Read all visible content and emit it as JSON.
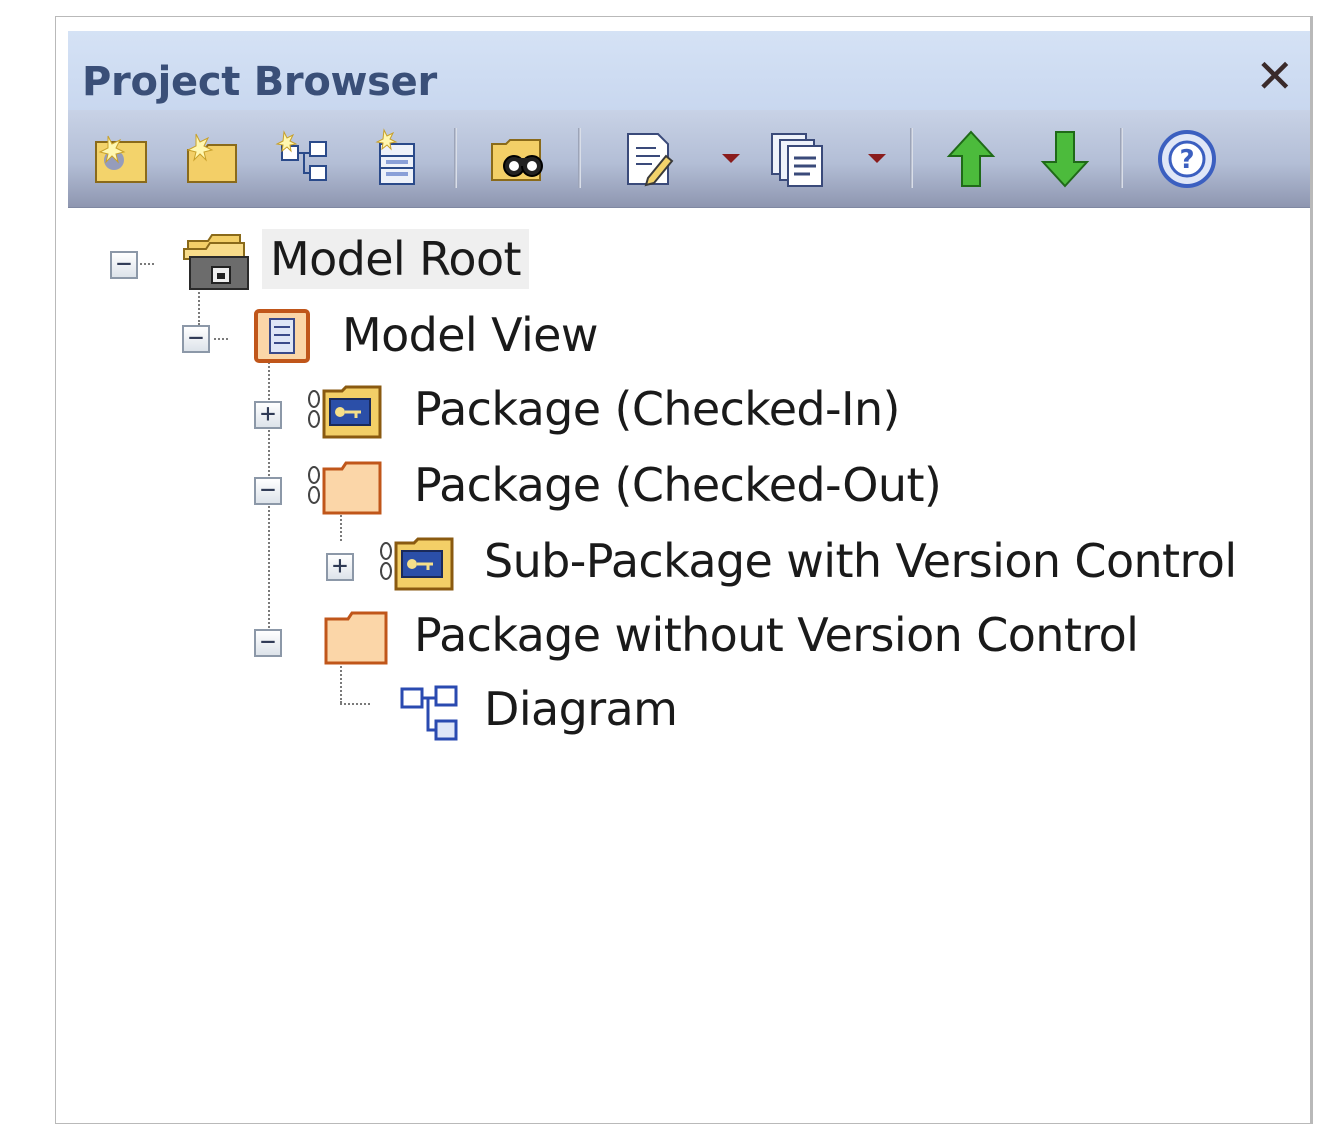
{
  "window": {
    "title": "Project Browser",
    "close_glyph": "✕"
  },
  "toolbar": {
    "buttons": [
      {
        "name": "new-model-package-icon"
      },
      {
        "name": "new-package-icon"
      },
      {
        "name": "new-diagram-icon"
      },
      {
        "name": "new-element-icon"
      },
      {
        "name": "find-in-browser-icon"
      },
      {
        "name": "add-to-document-icon"
      },
      {
        "name": "documentation-options-icon"
      },
      {
        "name": "move-up-icon"
      },
      {
        "name": "move-down-icon"
      },
      {
        "name": "help-icon"
      }
    ]
  },
  "tree": {
    "model_root": "Model Root",
    "model_view": "Model View",
    "package_checked_in": "Package (Checked-In)",
    "package_checked_out": "Package (Checked-Out)",
    "sub_package": "Sub-Package with Version Control",
    "package_no_vc": "Package without Version Control",
    "diagram": "Diagram"
  },
  "expanders": {
    "collapse": "−",
    "expand": "+"
  },
  "colors": {
    "title_text": "#3a4f78",
    "titlebar_bg": "#cddbf2",
    "folder_fill": "#fbd6a8",
    "folder_stroke": "#c58a3a",
    "arrow_up": "#3aa63a",
    "arrow_down": "#3aa63a",
    "help_ring": "#3b5fc0"
  }
}
